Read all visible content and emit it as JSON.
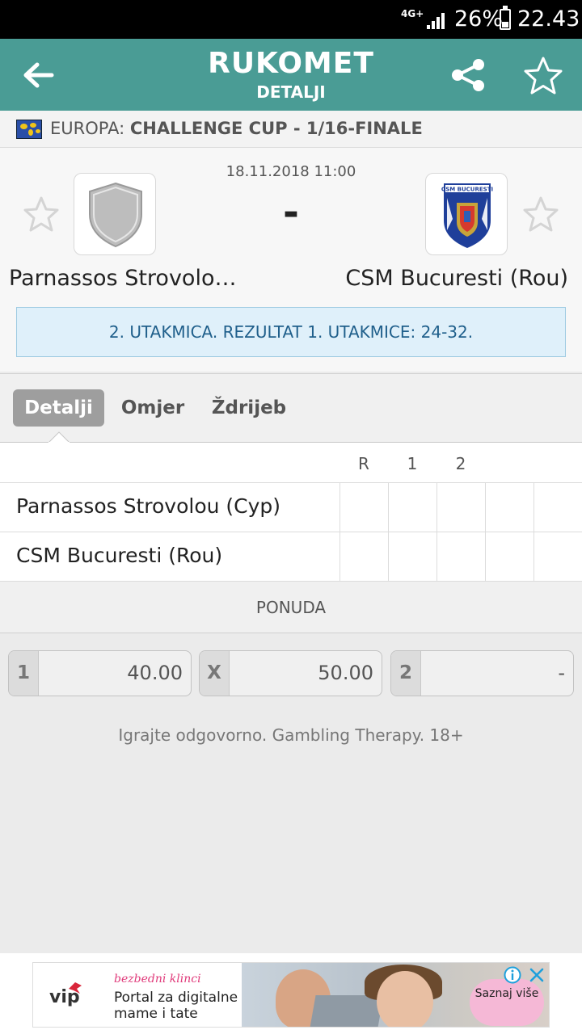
{
  "status_bar": {
    "network": "4G+",
    "battery": "26%",
    "time": "22.43"
  },
  "header": {
    "title": "RUKOMET",
    "subtitle": "DETALJI"
  },
  "competition": {
    "region": "EUROPA:",
    "name": "CHALLENGE CUP - 1/16-FINALE"
  },
  "match": {
    "date": "18.11.2018 11:00",
    "score": "-",
    "home_team": "Parnassos Strovolo…",
    "away_team": "CSM Bucuresti (Rou)",
    "away_logo_text": "CSM BUCURESTI",
    "info": "2. UTAKMICA. REZULTAT 1. UTAKMICE: 24-32."
  },
  "tabs": [
    {
      "label": "Detalji",
      "active": true
    },
    {
      "label": "Omjer",
      "active": false
    },
    {
      "label": "Ždrijeb",
      "active": false
    }
  ],
  "results": {
    "columns": [
      "R",
      "1",
      "2"
    ],
    "rows": [
      {
        "team": "Parnassos Strovolou (Cyp)"
      },
      {
        "team": "CSM Bucuresti (Rou)"
      }
    ]
  },
  "offer": {
    "title": "PONUDA",
    "odds": [
      {
        "label": "1",
        "value": "40.00"
      },
      {
        "label": "X",
        "value": "50.00"
      },
      {
        "label": "2",
        "value": "-"
      }
    ],
    "disclaimer": "Igrajte odgovorno. Gambling Therapy. 18+"
  },
  "ad": {
    "brand": "vip",
    "tagline": "bezbedni klinci",
    "line1": "Portal za digitalne",
    "line2": "mame i tate",
    "cta": "Saznaj više"
  },
  "colors": {
    "header": "#4a9c95",
    "info_bg": "#dff0fa",
    "info_text": "#1f5f8b",
    "tab_active": "#9e9e9e"
  }
}
